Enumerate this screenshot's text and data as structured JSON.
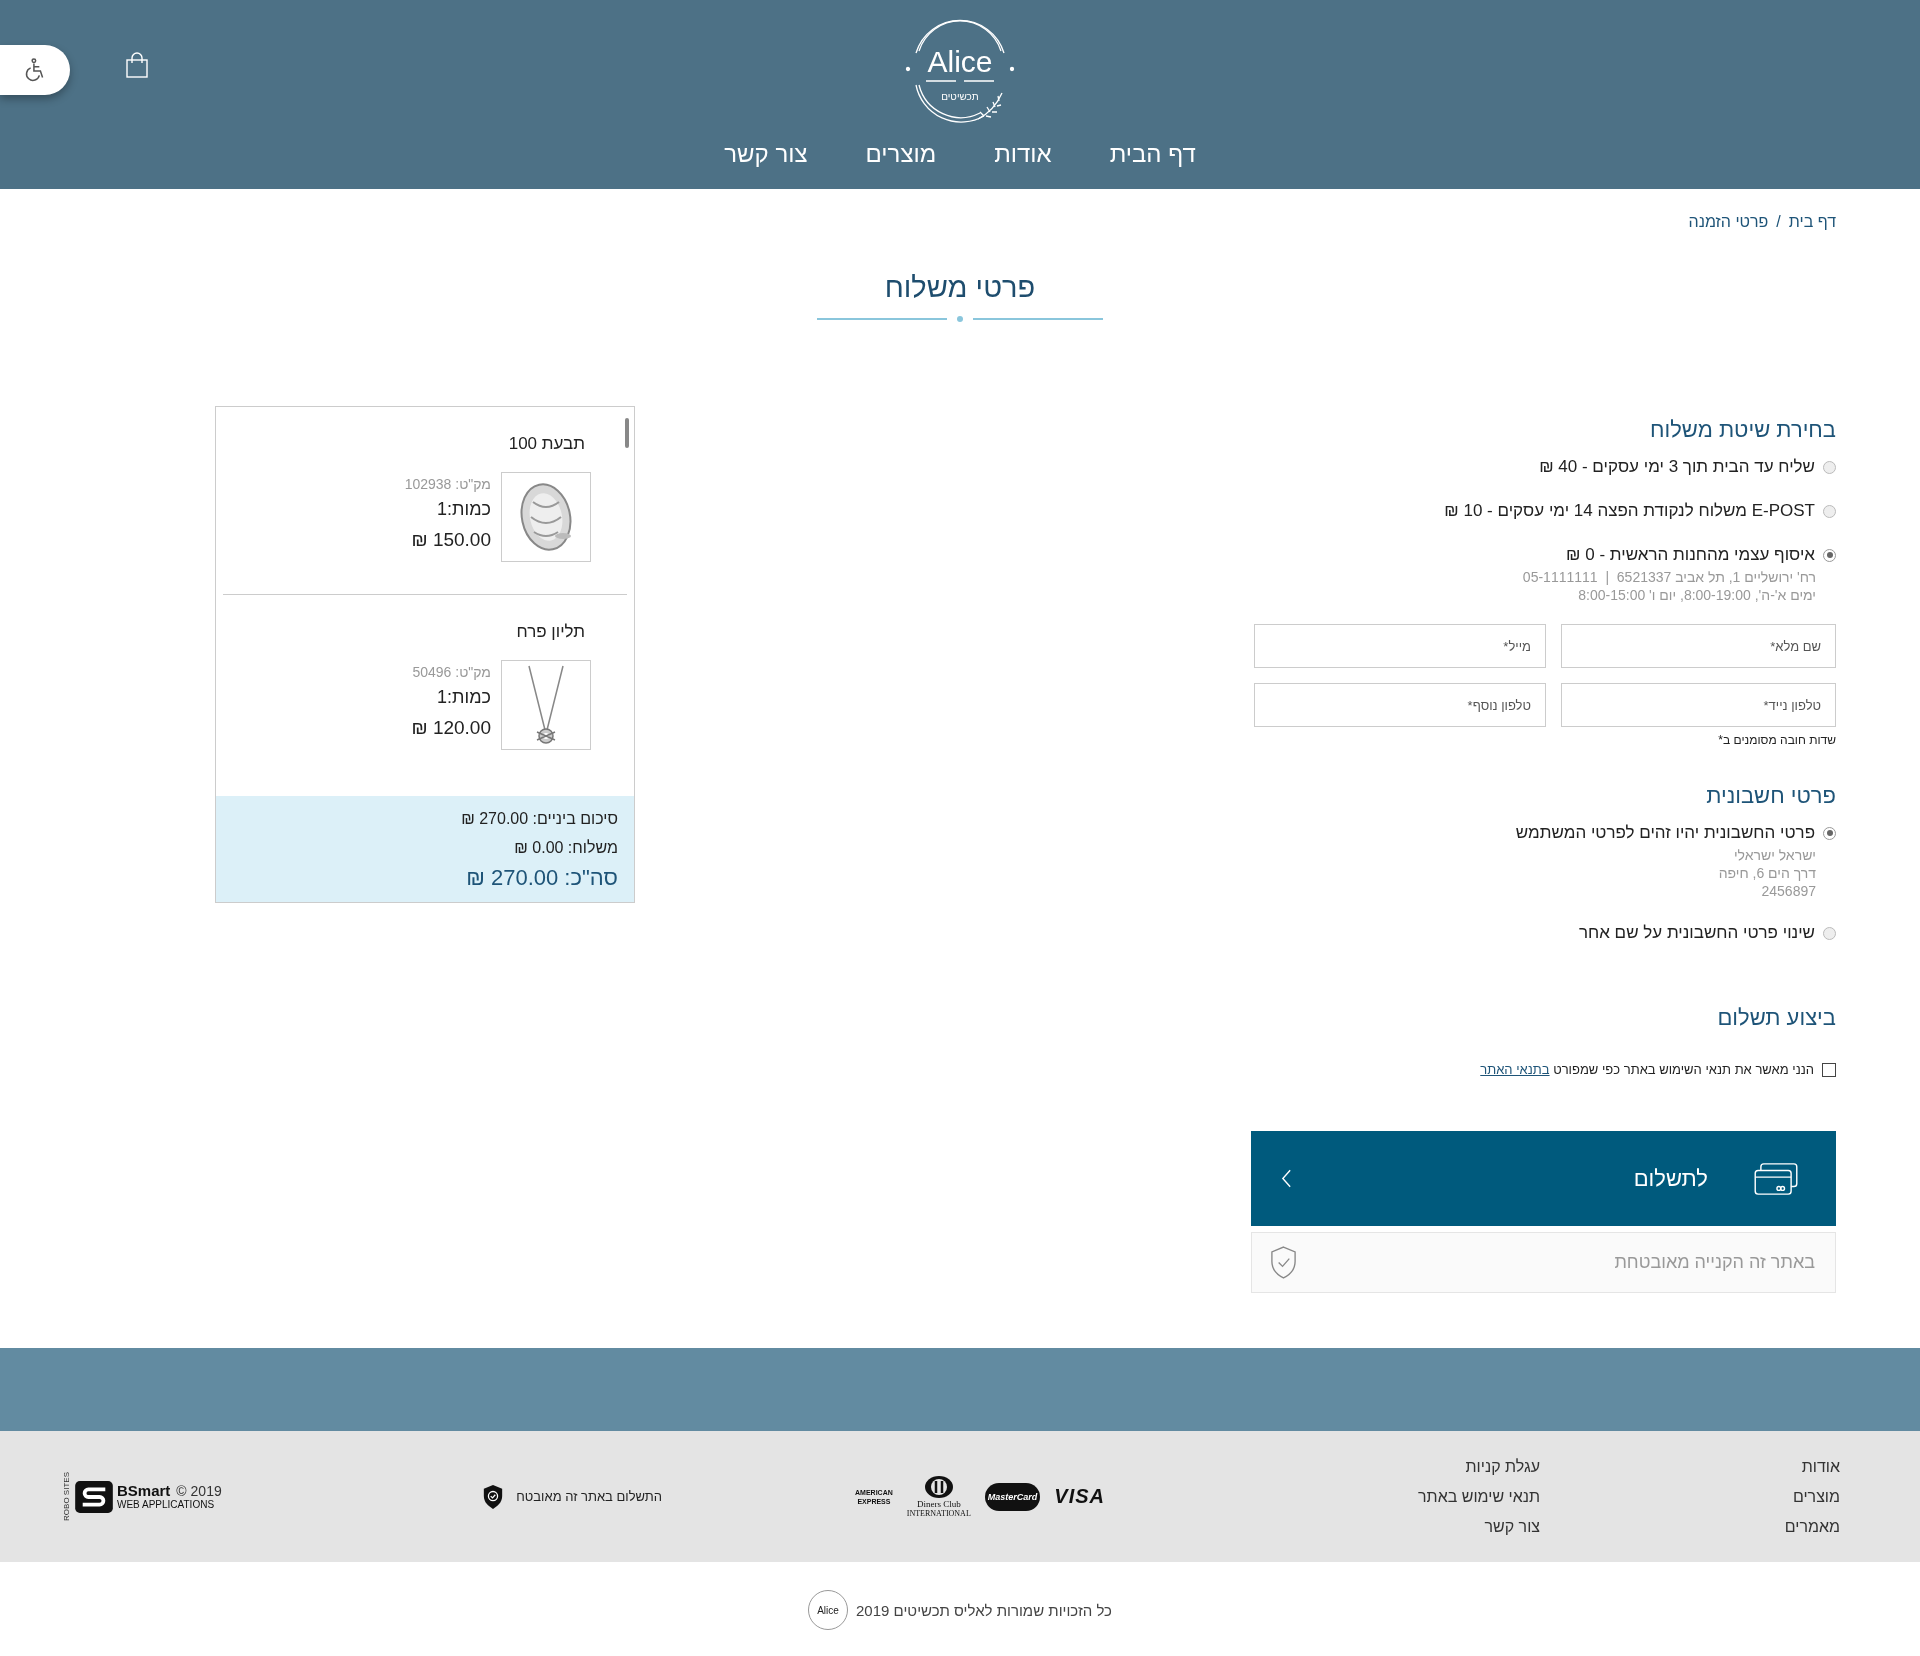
{
  "logo": {
    "name": "Alice",
    "tagline": "תכשיטים"
  },
  "nav": [
    {
      "label": "דף הבית"
    },
    {
      "label": "אודות"
    },
    {
      "label": "מוצרים"
    },
    {
      "label": "צור קשר"
    }
  ],
  "breadcrumb": {
    "items": [
      "דף בית",
      "פרטי הזמנה"
    ],
    "separator": "/"
  },
  "page_title": "פרטי משלוח",
  "shipping": {
    "heading": "בחירת שיטת משלוח",
    "options": [
      {
        "label": "שליח עד הבית תוך 3 ימי עסקים - 40 ₪",
        "selected": false
      },
      {
        "label": "E-POST משלוח לנקודת הפצה 14 ימי עסקים - 10 ₪",
        "selected": false
      },
      {
        "label": "איסוף עצמי מהחנות הראשית - 0 ₪",
        "selected": true,
        "details": [
          "רח' ירושליים 1, תל אביב 6521337  |  05-1111111",
          "ימים א'-ה', 8:00-19:00, יום ו' 8:00-15:00"
        ]
      }
    ]
  },
  "fields": [
    {
      "placeholder": "שם מלא*"
    },
    {
      "placeholder": "מייל*"
    },
    {
      "placeholder": "טלפון נייד*"
    },
    {
      "placeholder": "טלפון נוסף*"
    }
  ],
  "required_note": "שדות חובה מסומנים ב*",
  "billing": {
    "heading": "פרטי חשבונית",
    "options": [
      {
        "label": "פרטי החשבונית יהיו זהים לפרטי המשתמש",
        "selected": true,
        "details": [
          "ישראל ישראלי",
          "דרך הים 6, חיפה",
          "2456897"
        ]
      },
      {
        "label": "שינוי פרטי החשבונית על שם אחר",
        "selected": false
      }
    ]
  },
  "payment": {
    "heading": "ביצוע תשלום",
    "terms": {
      "text": "הנני מאשר את תנאי השימוש באתר כפי שמפורט",
      "link": "בתנאי האתר",
      "checked": false
    },
    "pay_button": "לתשלום",
    "secure_note": "באתר זה הקנייה מאובטחת"
  },
  "cart": {
    "items": [
      {
        "name": "תבעת 100",
        "sku": "מק\"ט: 102938",
        "quantity": "כמות:1",
        "price": "150.00 ₪"
      },
      {
        "name": "תליון פרח",
        "sku": "מק\"ט: 50496",
        "quantity": "כמות:1",
        "price": "120.00 ₪"
      }
    ],
    "subtotal": "סיכום ביניים: 270.00 ₪",
    "shipping": "משלוח: 0.00 ₪",
    "total": "סה\"כ: 270.00 ₪"
  },
  "footer": {
    "links_1": [
      "אודות",
      "מוצרים",
      "מאמרים"
    ],
    "links_2": [
      "עגלת קניות",
      "תנאי שימוש באתר",
      "צור קשר"
    ],
    "payment_logos": [
      {
        "kind": "visa",
        "text": "VISA"
      },
      {
        "kind": "mastercard",
        "text": "MasterCard"
      },
      {
        "kind": "diners",
        "text": "Diners Club",
        "sub": "INTERNATIONAL"
      },
      {
        "kind": "amex",
        "text": "AMERICAN EXPRESS"
      }
    ],
    "secure_note": "התשלום באתר זה מאובטח",
    "developer": {
      "side": "ROBO SITES",
      "name": "BSmart",
      "year": "© 2019",
      "subtitle": "WEB APPLICATIONS"
    },
    "copyright_logo": "Alice",
    "copyright": "כל הזכויות שמורות לאליס תכשיטים 2019"
  }
}
